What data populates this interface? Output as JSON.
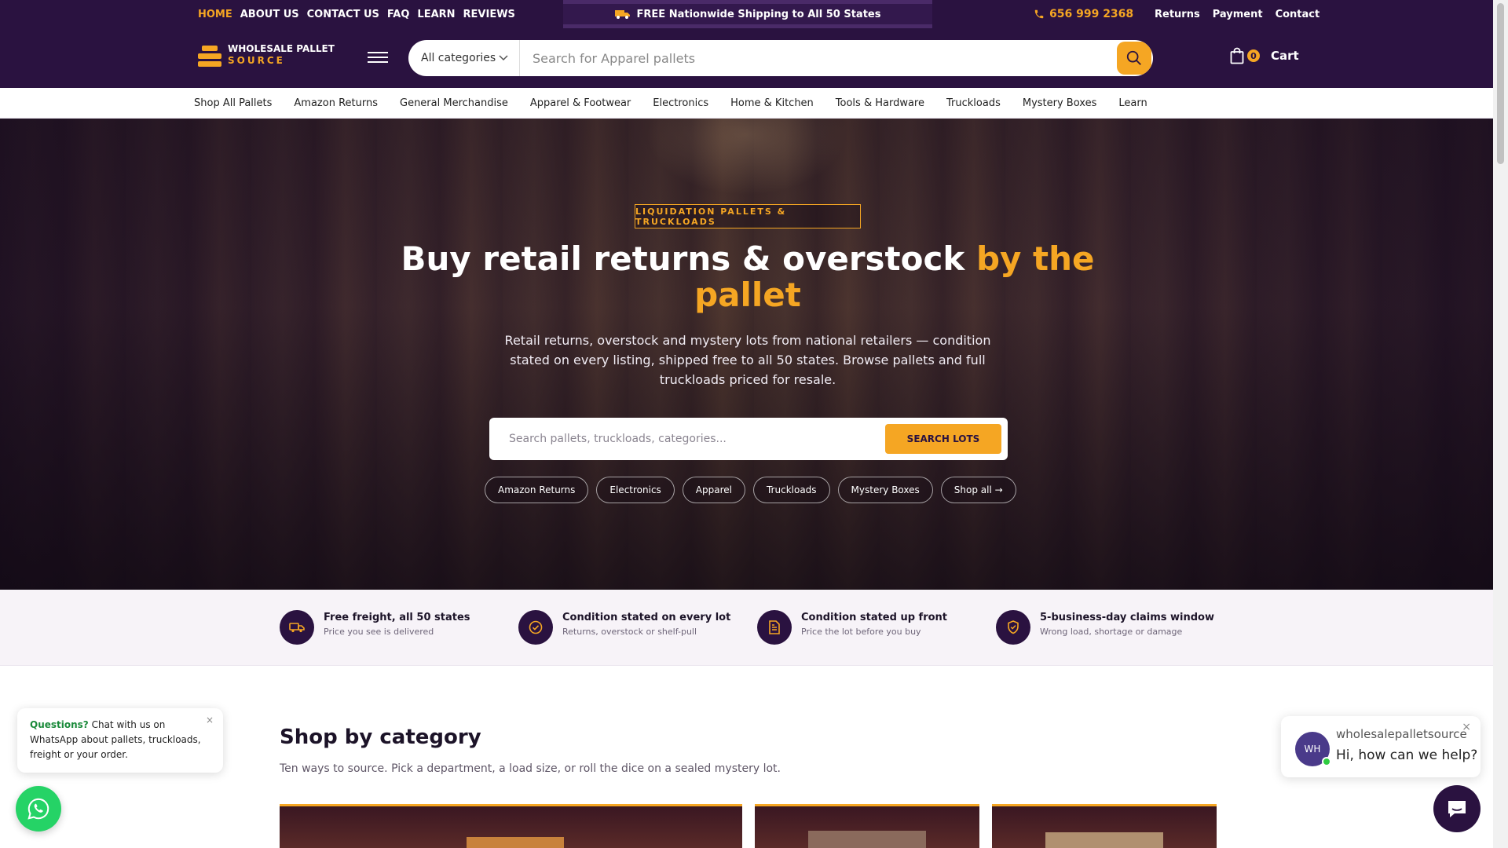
{
  "topbar": {
    "nav": [
      "HOME",
      "ABOUT US",
      "CONTACT US",
      "FAQ",
      "LEARN",
      "REVIEWS"
    ],
    "promo": "FREE Nationwide Shipping to All 50 States",
    "phone": "656 999 2368",
    "utility": [
      "Returns",
      "Payment",
      "Contact"
    ]
  },
  "header": {
    "logo_line1": "WHOLESALE PALLET",
    "logo_line2": "SOURCE",
    "category_select": "All categories",
    "search_placeholder": "Search for Apparel pallets",
    "cart_count": "0",
    "cart_label": "Cart"
  },
  "category_nav": [
    "Shop All Pallets",
    "Amazon Returns",
    "General Merchandise",
    "Apparel & Footwear",
    "Electronics",
    "Home & Kitchen",
    "Tools & Hardware",
    "Truckloads",
    "Mystery Boxes",
    "Learn"
  ],
  "hero": {
    "eyebrow": "LIQUIDATION PALLETS & TRUCKLOADS",
    "title_main": "Buy retail returns & overstock ",
    "title_accent": "by the pallet",
    "subtitle": "Retail returns, overstock and mystery lots from national retailers — condition stated on every listing, shipped free to all 50 states. Browse pallets and full truckloads priced for resale.",
    "search_placeholder": "Search pallets, truckloads, categories...",
    "search_button": "SEARCH LOTS",
    "chips": [
      "Amazon Returns",
      "Electronics",
      "Apparel",
      "Truckloads",
      "Mystery Boxes",
      "Shop all →"
    ]
  },
  "features": [
    {
      "title": "Free freight, all 50 states",
      "desc": "Price you see is delivered",
      "icon": "truck-icon"
    },
    {
      "title": "Condition stated on every lot",
      "desc": "Returns, overstock or shelf-pull",
      "icon": "check-circle-icon"
    },
    {
      "title": "Condition stated up front",
      "desc": "Price the lot before you buy",
      "icon": "document-icon"
    },
    {
      "title": "5-business-day claims window",
      "desc": "Wrong load, shortage or damage",
      "icon": "shield-check-icon"
    }
  ],
  "shop": {
    "title": "Shop by category",
    "subtitle": "Ten ways to source. Pick a department, a load size, or roll the dice on a sealed mystery lot."
  },
  "whatsapp": {
    "bold": "Questions?",
    "text": " Chat with us on WhatsApp about pallets, truckloads, freight or your order.",
    "close": "×"
  },
  "chat": {
    "avatar": "WH",
    "name": "wholesalepalletsource",
    "message": "Hi, how can we help?",
    "close": "×"
  },
  "colors": {
    "brand_purple": "#2a1240",
    "accent_orange": "#f5a623",
    "whatsapp_green": "#25d366"
  }
}
